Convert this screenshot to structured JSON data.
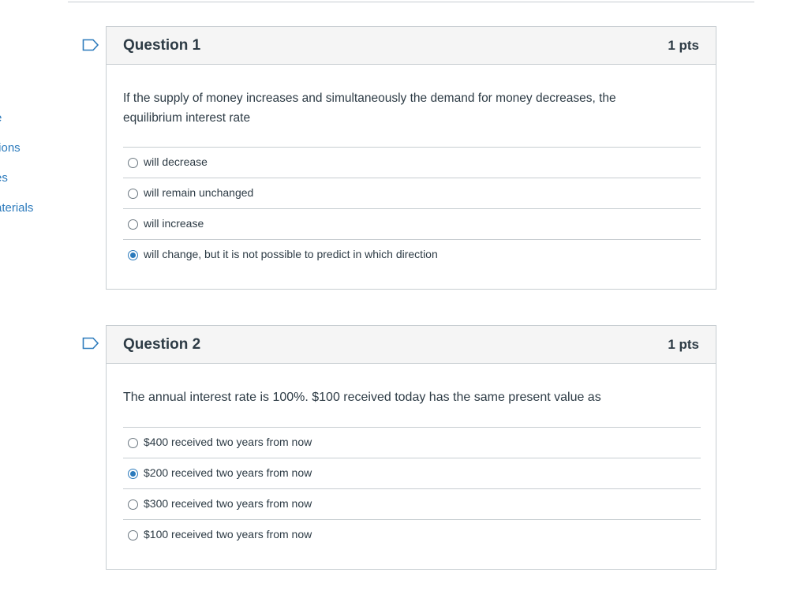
{
  "nav": {
    "items": [
      {
        "label": "e"
      },
      {
        "label": "tions"
      },
      {
        "label": "es"
      },
      {
        "label": "aterials"
      }
    ]
  },
  "questions": [
    {
      "title": "Question 1",
      "points": "1 pts",
      "text": "If the supply of money increases and simultaneously the demand for money decreases, the equilibrium  interest rate",
      "answers": [
        {
          "label": "will decrease",
          "selected": false
        },
        {
          "label": "will remain unchanged",
          "selected": false
        },
        {
          "label": "will increase",
          "selected": false
        },
        {
          "label": "will change, but it is not possible to predict in which direction",
          "selected": true
        }
      ]
    },
    {
      "title": "Question 2",
      "points": "1 pts",
      "text": "The annual interest rate is 100%. $100 received today has the same present value as",
      "answers": [
        {
          "label": "$400 received two years from now",
          "selected": false
        },
        {
          "label": "$200 received two years from now",
          "selected": true
        },
        {
          "label": "$300 received two years from now",
          "selected": false
        },
        {
          "label": "$100 received two years from now",
          "selected": false
        }
      ]
    }
  ],
  "colors": {
    "link": "#2b7abc",
    "text": "#2d3b45",
    "border": "#c7cdd1",
    "header_bg": "#f5f5f5"
  }
}
